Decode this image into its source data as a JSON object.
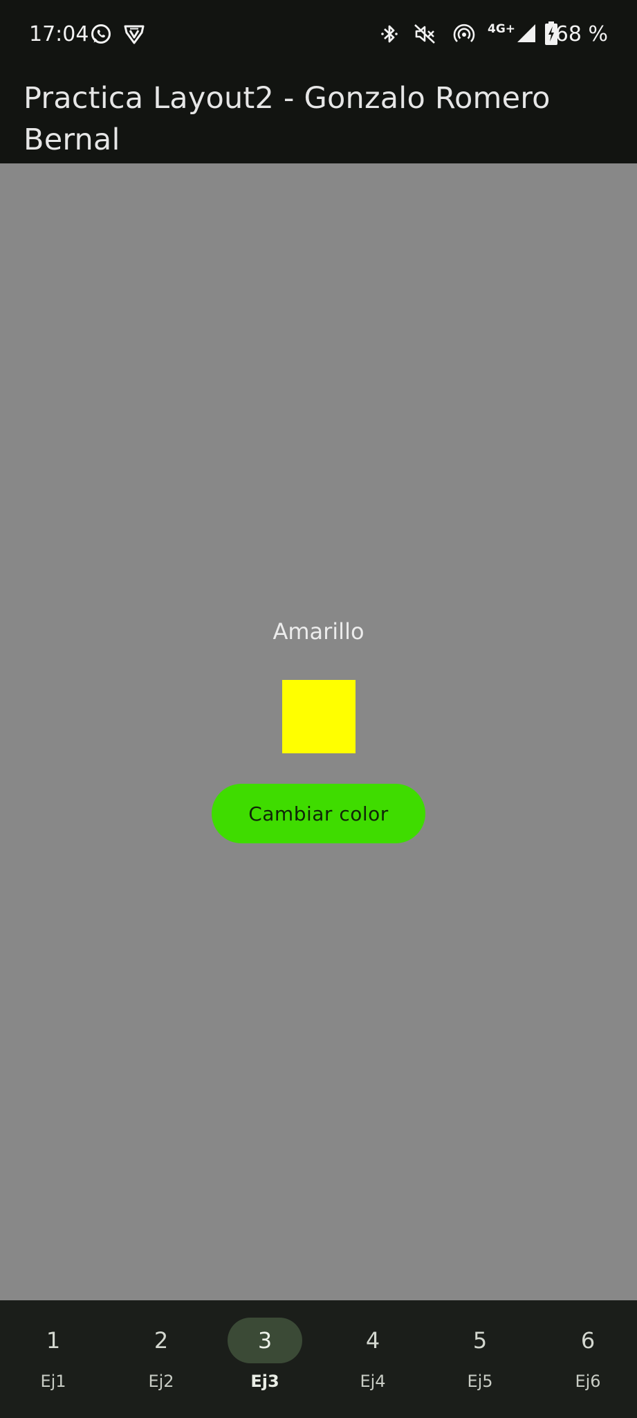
{
  "status_bar": {
    "time": "17:04",
    "network": "4G+",
    "battery": "68 %",
    "icons": [
      "whatsapp-icon",
      "shield-v-icon",
      "bluetooth-icon",
      "mute-icon",
      "hotspot-icon",
      "signal-icon",
      "battery-charging-icon"
    ]
  },
  "app_bar": {
    "title": "Practica Layout2 - Gonzalo Romero Bernal"
  },
  "main": {
    "color_name": "Amarillo",
    "swatch_color": "#ffff00",
    "button_label": "Cambiar color"
  },
  "colors": {
    "background": "#888888",
    "bar": "#121411",
    "button": "#3fdc00",
    "nav_bg": "#1b1e1a",
    "nav_active": "#3b4a36"
  },
  "bottom_nav": {
    "selected": "3",
    "items": [
      {
        "icon": "1",
        "label": "Ej1"
      },
      {
        "icon": "2",
        "label": "Ej2"
      },
      {
        "icon": "3",
        "label": "Ej3"
      },
      {
        "icon": "4",
        "label": "Ej4"
      },
      {
        "icon": "5",
        "label": "Ej5"
      },
      {
        "icon": "6",
        "label": "Ej6"
      }
    ]
  }
}
